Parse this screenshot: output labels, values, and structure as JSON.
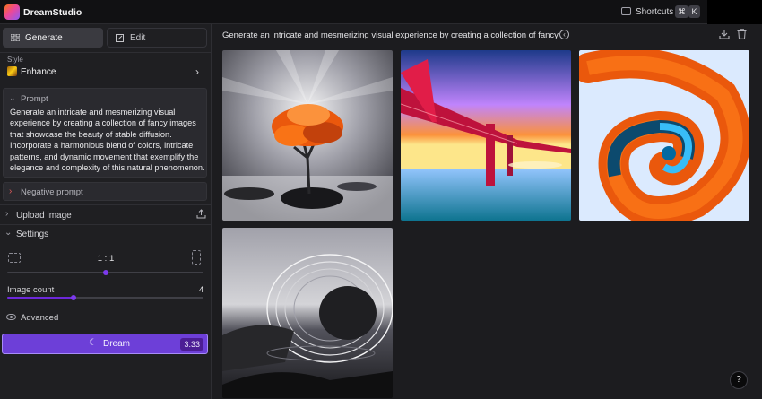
{
  "app": {
    "name": "DreamStudio",
    "shortcuts_label": "Shortcuts",
    "shortcut_keys": [
      "⌘",
      "K"
    ]
  },
  "sidebar": {
    "tabs": [
      {
        "label": "Generate",
        "icon": "grid-icon"
      },
      {
        "label": "Edit",
        "icon": "edit-icon"
      }
    ],
    "style": {
      "label": "Style",
      "value": "Enhance"
    },
    "prompt": {
      "title": "Prompt",
      "text": "Generate an intricate and mesmerizing visual experience by creating a collection of fancy images that showcase the beauty of stable diffusion. Incorporate a harmonious blend of colors, intricate patterns, and dynamic movement that exemplify the elegance and complexity of this natural phenomenon."
    },
    "negative_prompt": {
      "title": "Negative prompt"
    },
    "upload": {
      "label": "Upload image"
    },
    "settings": {
      "label": "Settings",
      "aspect_ratio": "1 : 1",
      "aspect_slider_fraction": 0.5,
      "image_count_label": "Image count",
      "image_count": "4",
      "image_count_fraction": 0.34
    },
    "advanced": {
      "label": "Advanced"
    },
    "dream": {
      "label": "Dream",
      "cost": "3.33"
    }
  },
  "main": {
    "prompt_header": "Generate an intricate and mesmerizing visual experience by creating a collection of fancy i...",
    "images": [
      {
        "name": "orange-tree-on-rock"
      },
      {
        "name": "red-bridge-sunset"
      },
      {
        "name": "orange-spiral-shell"
      },
      {
        "name": "monochrome-wire-sphere"
      }
    ],
    "help_label": "?"
  },
  "colors": {
    "accent": "#6d3fd8",
    "accent_border": "#a78bfa",
    "background": "#1c1c1f",
    "sidebar": "#1f1f22"
  }
}
